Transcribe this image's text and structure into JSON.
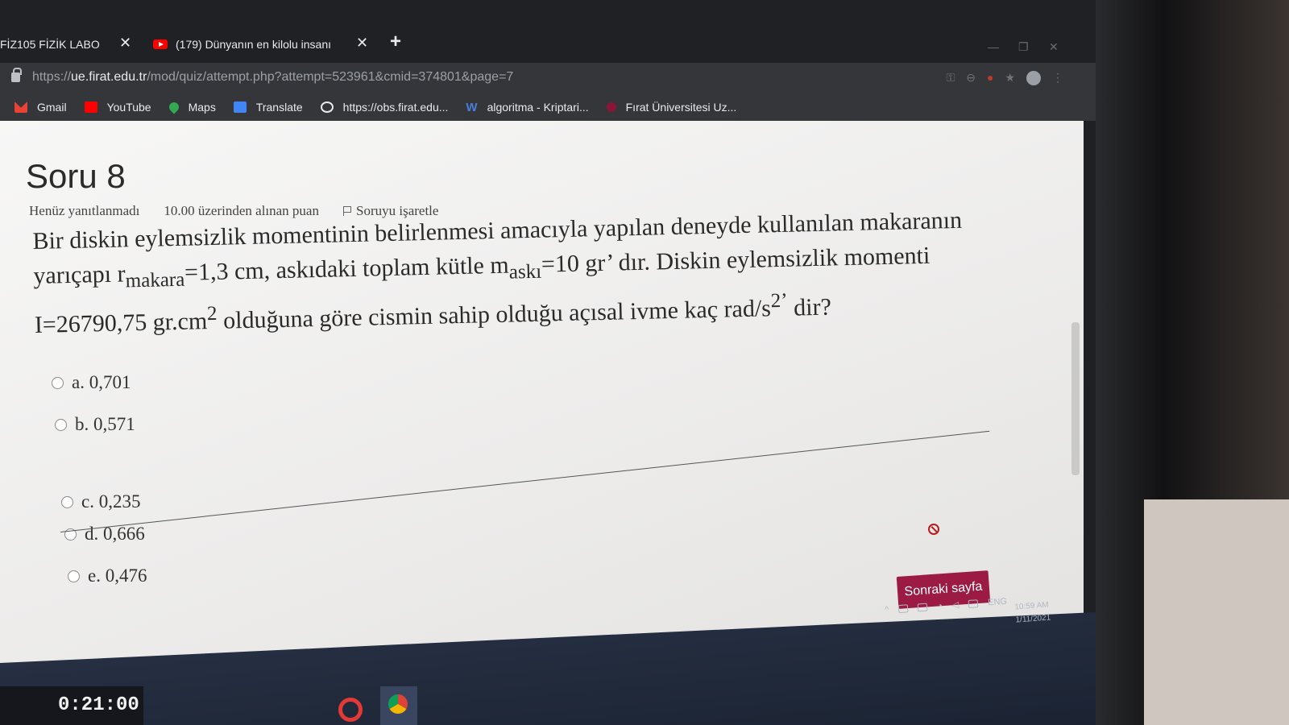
{
  "browser": {
    "tabs": [
      {
        "title": "FİZ105 FİZİK LABO"
      },
      {
        "title": "(179) Dünyanın en kilolu insanı"
      }
    ],
    "address_bar": {
      "scheme": "https://",
      "host": "ue.firat.edu.tr",
      "path": "/mod/quiz/attempt.php?attempt=523961&cmid=374801&page=7"
    },
    "bookmarks": [
      {
        "label": "Gmail",
        "icon": "gmail-icon"
      },
      {
        "label": "YouTube",
        "icon": "youtube-icon"
      },
      {
        "label": "Maps",
        "icon": "maps-icon"
      },
      {
        "label": "Translate",
        "icon": "translate-icon"
      },
      {
        "label": "https://obs.firat.edu...",
        "icon": "globe-icon"
      },
      {
        "label": "algoritma - Kriptari...",
        "icon": "w-icon"
      },
      {
        "label": "Fırat Üniversitesi Uz...",
        "icon": "firat-icon"
      }
    ]
  },
  "question": {
    "title": "Soru 8",
    "status": "Henüz yanıtlanmadı",
    "points": "10.00 üzerinden alınan puan",
    "flag_label": "Soruyu işaretle",
    "text_part1": "Bir diskin eylemsizlik momentinin belirlenmesi amacıyla yapılan deneyde kullanılan makaranın yarıçapı r",
    "sub_makara": "makara",
    "text_part2": "=1,3 cm, askıdaki toplam kütle m",
    "sub_aski": "askı",
    "text_part3": "=10 gr’ dır. Diskin eylemsizlik momenti I=26790,75 gr.cm",
    "sup_2": "2",
    "text_part4": " olduğuna göre cismin sahip olduğu açısal ivme kaç rad/s",
    "sup_2b": "2’",
    "text_part5": " dir?",
    "answers": [
      {
        "label": "a. 0,701"
      },
      {
        "label": "b. 0,571"
      },
      {
        "label": "c. 0,235"
      },
      {
        "label": "d. 0,666"
      },
      {
        "label": "e. 0,476"
      }
    ],
    "next_button": "Sonraki sayfa"
  },
  "taskbar": {
    "timer": "0:21:00",
    "language": "ENG",
    "time": "10:59 AM",
    "date": "1/11/2021"
  },
  "colors": {
    "accent_button": "#9c1b45",
    "browser_chrome": "#35363a"
  }
}
